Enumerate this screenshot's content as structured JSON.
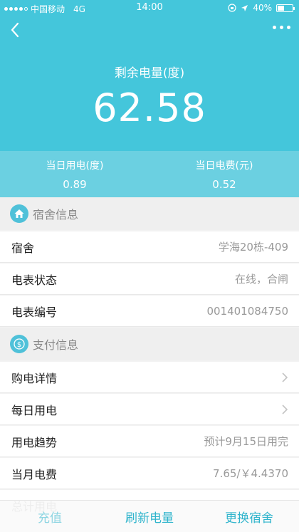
{
  "statusbar": {
    "carrier": "中国移动",
    "network": "4G",
    "time": "14:00",
    "battery": "40%"
  },
  "hero": {
    "remain_label": "剩余电量(度)",
    "remain_value": "62.58"
  },
  "daily": {
    "usage_label": "当日用电(度)",
    "usage_value": "0.89",
    "cost_label": "当日电费(元)",
    "cost_value": "0.52"
  },
  "dorm_section": {
    "title": "宿舍信息",
    "icon": "home-icon",
    "rows": [
      {
        "key": "宿舍",
        "value": "学海20栋-409"
      },
      {
        "key": "电表状态",
        "value": "在线，合闸"
      },
      {
        "key": "电表编号",
        "value": "001401084750"
      }
    ]
  },
  "pay_section": {
    "title": "支付信息",
    "icon": "dollar-icon",
    "rows": [
      {
        "key": "购电详情",
        "value": ""
      },
      {
        "key": "每日用电",
        "value": ""
      },
      {
        "key": "用电趋势",
        "value": "预计9月15日用完"
      },
      {
        "key": "当月电费",
        "value": "7.65/￥4.4370"
      },
      {
        "key": "总计用电",
        "value": ""
      }
    ]
  },
  "tabbar": {
    "recharge": "充值",
    "refresh": "刷新电量",
    "switch_dorm": "更换宿舍"
  },
  "colors": {
    "primary": "#44c6db",
    "strip": "#6bd0e1",
    "tab_text": "#2fb4cc"
  }
}
